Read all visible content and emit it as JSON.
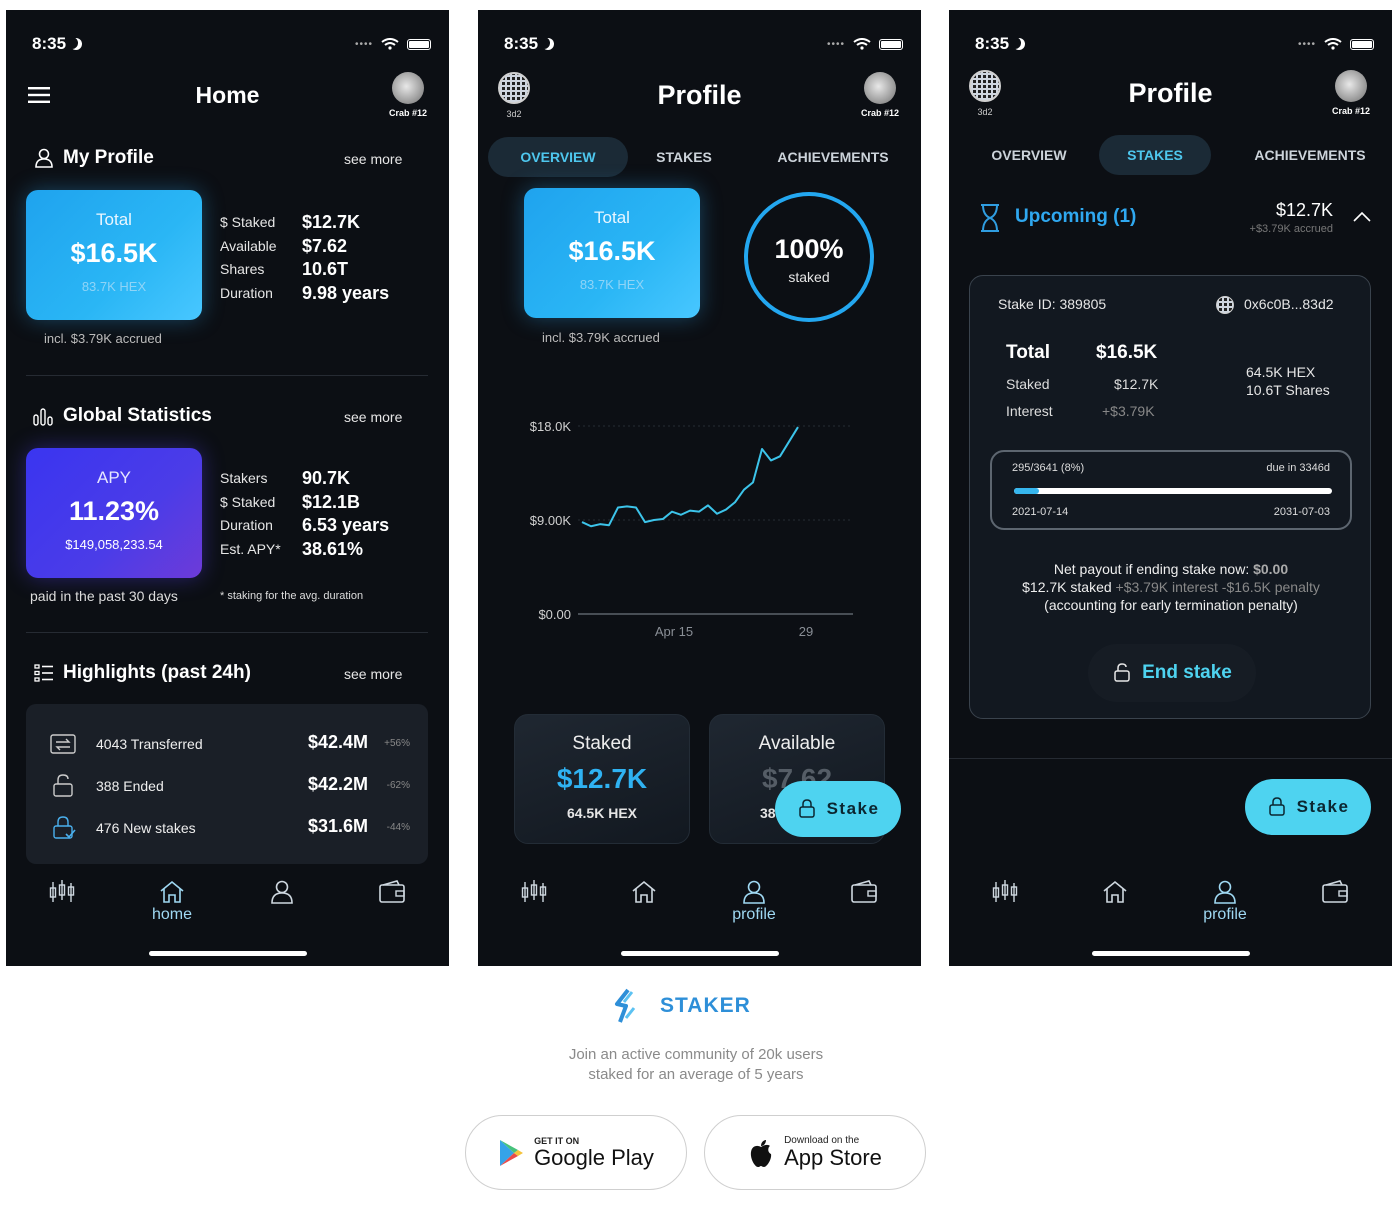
{
  "status": {
    "time": "8:35"
  },
  "avatar_label": "Crab #12",
  "hex_label": "3d2",
  "screen1": {
    "title": "Home",
    "my_profile": {
      "title": "My Profile",
      "see_more": "see more",
      "total_label": "Total",
      "total_value": "$16.5K",
      "total_hex": "83.7K HEX",
      "accrued_note": "incl. $3.79K accrued",
      "stats": [
        {
          "k": "$ Staked",
          "v": "$12.7K"
        },
        {
          "k": "Available",
          "v": "$7.62"
        },
        {
          "k": "Shares",
          "v": "10.6T"
        },
        {
          "k": "Duration",
          "v": "9.98 years"
        }
      ]
    },
    "global": {
      "title": "Global Statistics",
      "see_more": "see more",
      "apy_label": "APY",
      "apy_value": "11.23%",
      "apy_sub": "$149,058,233.54",
      "paid_note": "paid in the past 30 days",
      "staking_note": "* staking for the avg. duration",
      "stats": [
        {
          "k": "Stakers",
          "v": "90.7K"
        },
        {
          "k": "$ Staked",
          "v": "$12.1B"
        },
        {
          "k": "Duration",
          "v": "6.53 years"
        },
        {
          "k": "Est. APY*",
          "v": "38.61%"
        }
      ]
    },
    "highlights": {
      "title": "Highlights (past 24h)",
      "see_more": "see more",
      "rows": [
        {
          "label": "4043 Transferred",
          "value": "$42.4M",
          "pct": "+56%",
          "icon": "transfer-icon"
        },
        {
          "label": "388 Ended",
          "value": "$42.2M",
          "pct": "-62%",
          "icon": "unlock-icon"
        },
        {
          "label": "476 New stakes",
          "value": "$31.6M",
          "pct": "-44%",
          "icon": "lock-check-icon"
        }
      ]
    },
    "nav_active_label": "home"
  },
  "screen2": {
    "title": "Profile",
    "tabs": [
      "OVERVIEW",
      "STAKES",
      "ACHIEVEMENTS"
    ],
    "total_label": "Total",
    "total_value": "$16.5K",
    "total_hex": "83.7K HEX",
    "accrued_note": "incl. $3.79K accrued",
    "ring_big": "100%",
    "ring_small": "staked",
    "staked_card": {
      "title": "Staked",
      "value": "$12.7K",
      "sub": "64.5K HEX"
    },
    "available_card": {
      "title": "Available",
      "value": "$7.62",
      "sub": "38"
    },
    "stake_button": "Stake",
    "nav_active_label": "profile"
  },
  "chart_data": {
    "type": "line",
    "title": "",
    "y_ticks": [
      "$18.0K",
      "$9.00K",
      "$0.00"
    ],
    "x_ticks": [
      "Apr 15",
      "29"
    ],
    "ylim": [
      0,
      18000
    ],
    "values": [
      8800,
      8400,
      8600,
      8500,
      10200,
      10300,
      10200,
      8800,
      9000,
      9100,
      9800,
      9500,
      9900,
      9800,
      10400,
      9600,
      10000,
      10700,
      11900,
      12600,
      15800,
      14700,
      15100,
      16500,
      17900
    ],
    "grid": true
  },
  "screen3": {
    "title": "Profile",
    "tabs": [
      "OVERVIEW",
      "STAKES",
      "ACHIEVEMENTS"
    ],
    "upcoming_label": "Upcoming (1)",
    "upcoming_value": "$12.7K",
    "upcoming_accrued": "+$3.79K accrued",
    "stake_id": "Stake ID: 389805",
    "address": "0x6c0B...83d2",
    "total_label": "Total",
    "total_value": "$16.5K",
    "staked_label": "Staked",
    "staked_value": "$12.7K",
    "interest_label": "Interest",
    "interest_value": "+$3.79K",
    "hex_amount": "64.5K HEX",
    "shares": "10.6T Shares",
    "progress_text": "295/3641 (8%)",
    "due_text": "due in 3346d",
    "progress_fraction": 0.08,
    "start_date": "2021-07-14",
    "end_date": "2031-07-03",
    "payout_line1_prefix": "Net payout if ending stake now:",
    "payout_line1_value": "$0.00",
    "payout_line2_a": "$12.7K staked",
    "payout_line2_b": "+$3.79K interest",
    "payout_line2_c": "-$16.5K penalty",
    "payout_line3": "(accounting for early termination penalty)",
    "end_stake": "End stake",
    "stake_button": "Stake",
    "nav_active_label": "profile"
  },
  "footer": {
    "brand": "STAKER",
    "tagline1": "Join an active community of 20k users",
    "tagline2": "staked for an average of 5 years",
    "google_small": "GET IT ON",
    "google_big": "Google Play",
    "apple_small": "Download on the",
    "apple_big": "App Store"
  },
  "colors": {
    "accent": "#4ed3f0",
    "blue_card": "#2ab6f5",
    "purple_card": "#4b3ce8",
    "background": "#0c0f14"
  }
}
